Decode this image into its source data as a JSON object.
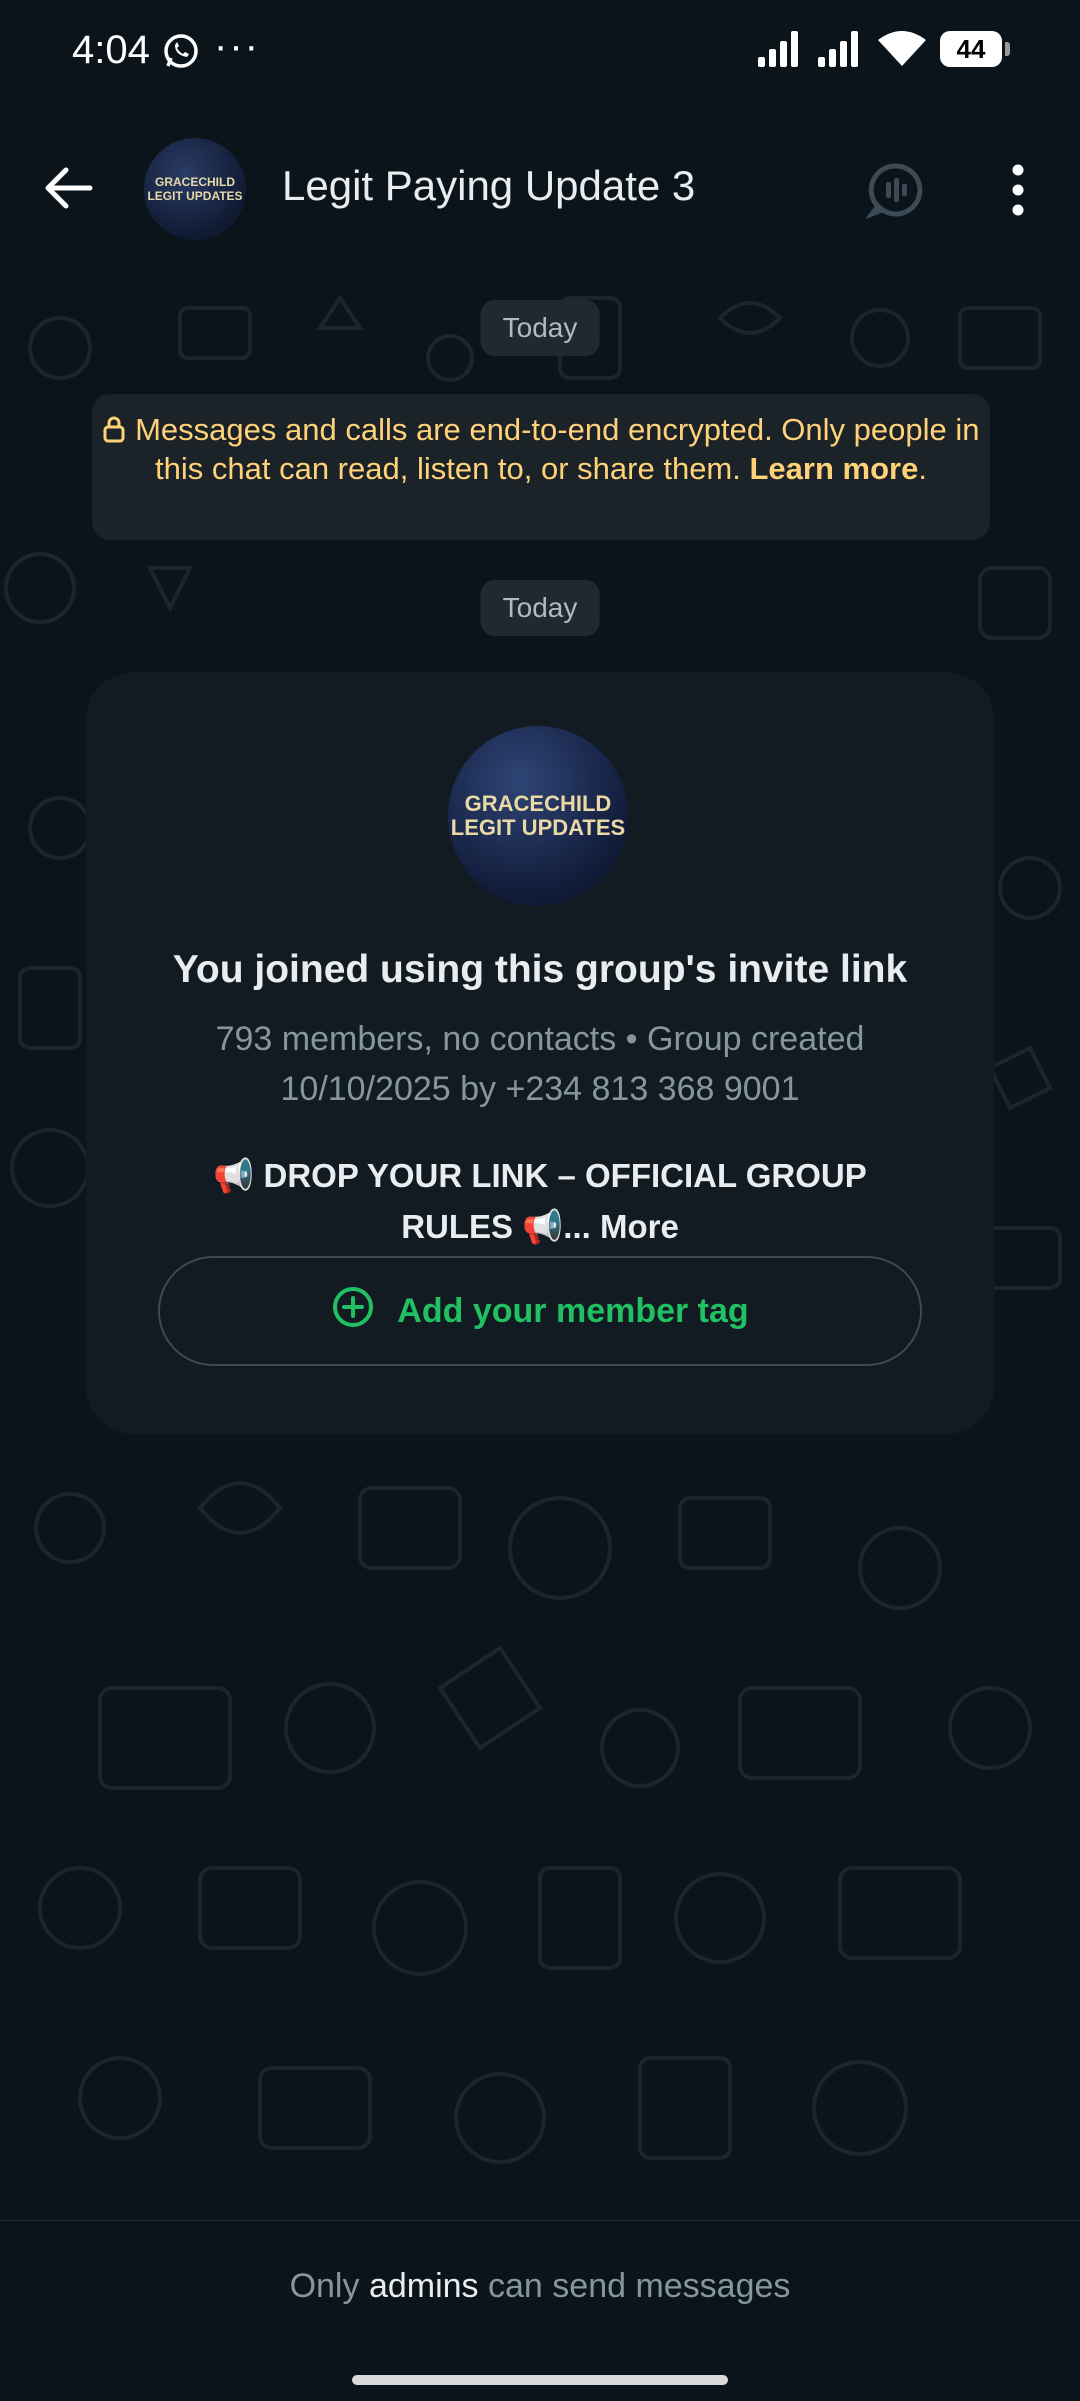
{
  "status_bar": {
    "time": "4:04",
    "battery": "44",
    "dots": "···"
  },
  "header": {
    "title": "Legit Paying Update 3",
    "avatar_line1": "GRACECHILD",
    "avatar_line2": "LEGIT UPDATES"
  },
  "chat": {
    "date_chip_1": "Today",
    "date_chip_2": "Today",
    "encryption_text": "Messages and calls are end-to-end encrypted. Only people in this chat can read, listen to, or share them.",
    "encryption_link": "Learn more",
    "encryption_end": "."
  },
  "group_card": {
    "avatar_line1": "GRACECHILD",
    "avatar_line2": "LEGIT UPDATES",
    "title": "You joined using this group's invite link",
    "meta": "793 members, no contacts • Group created 10/10/2025 by +234 813 368 9001",
    "description": "📢 DROP YOUR LINK – OFFICIAL GROUP RULES 📢...",
    "more_label": "More",
    "tag_button_label": "Add your member tag"
  },
  "footer": {
    "prefix": "Only",
    "admins": "admins",
    "suffix": "can send messages"
  },
  "colors": {
    "accent_green": "#21c063",
    "encryption_yellow": "#ffd279",
    "background": "#0b141a"
  }
}
